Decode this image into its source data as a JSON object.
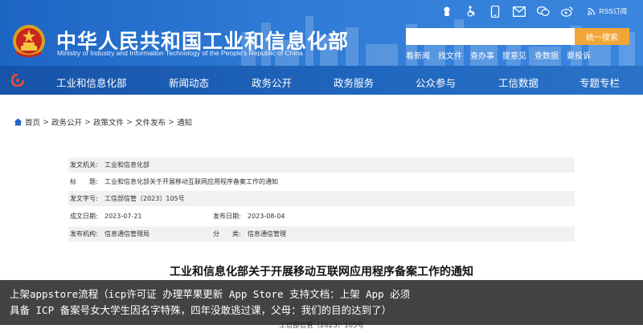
{
  "header": {
    "title_cn": "中华人民共和国工业和信息化部",
    "title_en": "Ministry of Industry and Information Technology of the People's Republic of China",
    "rss_label": "RSS订阅",
    "search": {
      "placeholder": "",
      "button_label": "统一搜索"
    },
    "quick_links": [
      "看新闻",
      "找文件",
      "查办事",
      "提意见",
      "查数据",
      "要投诉"
    ],
    "icons": [
      "mascot-icon",
      "accessibility-icon",
      "mobile-icon",
      "mail-icon",
      "wechat-icon",
      "weibo-icon",
      "rss-icon"
    ]
  },
  "nav": {
    "items": [
      "工业和信息化部",
      "新闻动态",
      "政务公开",
      "政务服务",
      "公众参与",
      "工信数据",
      "专题专栏"
    ]
  },
  "breadcrumb": [
    "首页",
    "政务公开",
    "政策文件",
    "文件发布",
    "通知"
  ],
  "meta": {
    "issuer_label": "发文机关:",
    "issuer_value": "工业和信息化部",
    "title_label": "标　　题:",
    "title_value": "工业和信息化部关于开展移动互联网应用程序备案工作的通知",
    "docno_label": "发文字号:",
    "docno_value": "工信部信管〔2023〕105号",
    "created_label": "成文日期:",
    "created_value": "2023-07-21",
    "published_label": "发布日期:",
    "published_value": "2023-08-04",
    "agency_label": "发布机构:",
    "agency_value": "信息通信管理局",
    "category_label": "分　　类:",
    "category_value": "信息通信管理"
  },
  "article": {
    "title": "工业和信息化部关于开展移动互联网应用程序备案工作的通知",
    "doc_number": "工信部信管〔2023〕105号"
  },
  "overlay": {
    "line1": "上架appstore流程（icp许可证 办理苹果更新 App Store 支持文档：上架 App 必须",
    "line2": "具备 ICP 备案号女大学生因名字特殊，四年没敢逃过课，父母：我们的目的达到了）"
  },
  "colors": {
    "header_blue": "#2f7bd6",
    "nav_blue": "#1d5fb6",
    "search_button": "#f3a638",
    "overlay_bg": "#141414"
  }
}
